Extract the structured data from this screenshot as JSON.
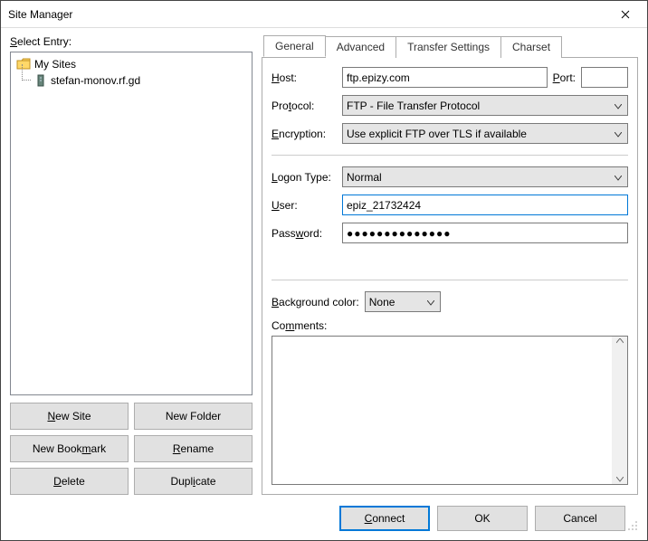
{
  "window": {
    "title": "Site Manager"
  },
  "left_panel": {
    "label": "Select Entry:",
    "tree": {
      "root": "My Sites",
      "item": "stefan-monov.rf.gd"
    },
    "buttons": {
      "new_site": "New Site",
      "new_folder": "New Folder",
      "new_bookmark": "New Bookmark",
      "rename": "Rename",
      "delete": "Delete",
      "duplicate": "Duplicate"
    }
  },
  "tabs": {
    "general": "General",
    "advanced": "Advanced",
    "transfer": "Transfer Settings",
    "charset": "Charset"
  },
  "general": {
    "host_label": "Host:",
    "host_value": "ftp.epizy.com",
    "port_label": "Port:",
    "port_value": "",
    "protocol_label": "Protocol:",
    "protocol_value": "FTP - File Transfer Protocol",
    "encryption_label": "Encryption:",
    "encryption_value": "Use explicit FTP over TLS if available",
    "logon_type_label": "Logon Type:",
    "logon_type_value": "Normal",
    "user_label": "User:",
    "user_value": "epiz_21732424",
    "password_label": "Password:",
    "password_value": "●●●●●●●●●●●●●●",
    "bgcolor_label": "Background color:",
    "bgcolor_value": "None",
    "comments_label": "Comments:"
  },
  "bottom": {
    "connect": "Connect",
    "ok": "OK",
    "cancel": "Cancel"
  }
}
